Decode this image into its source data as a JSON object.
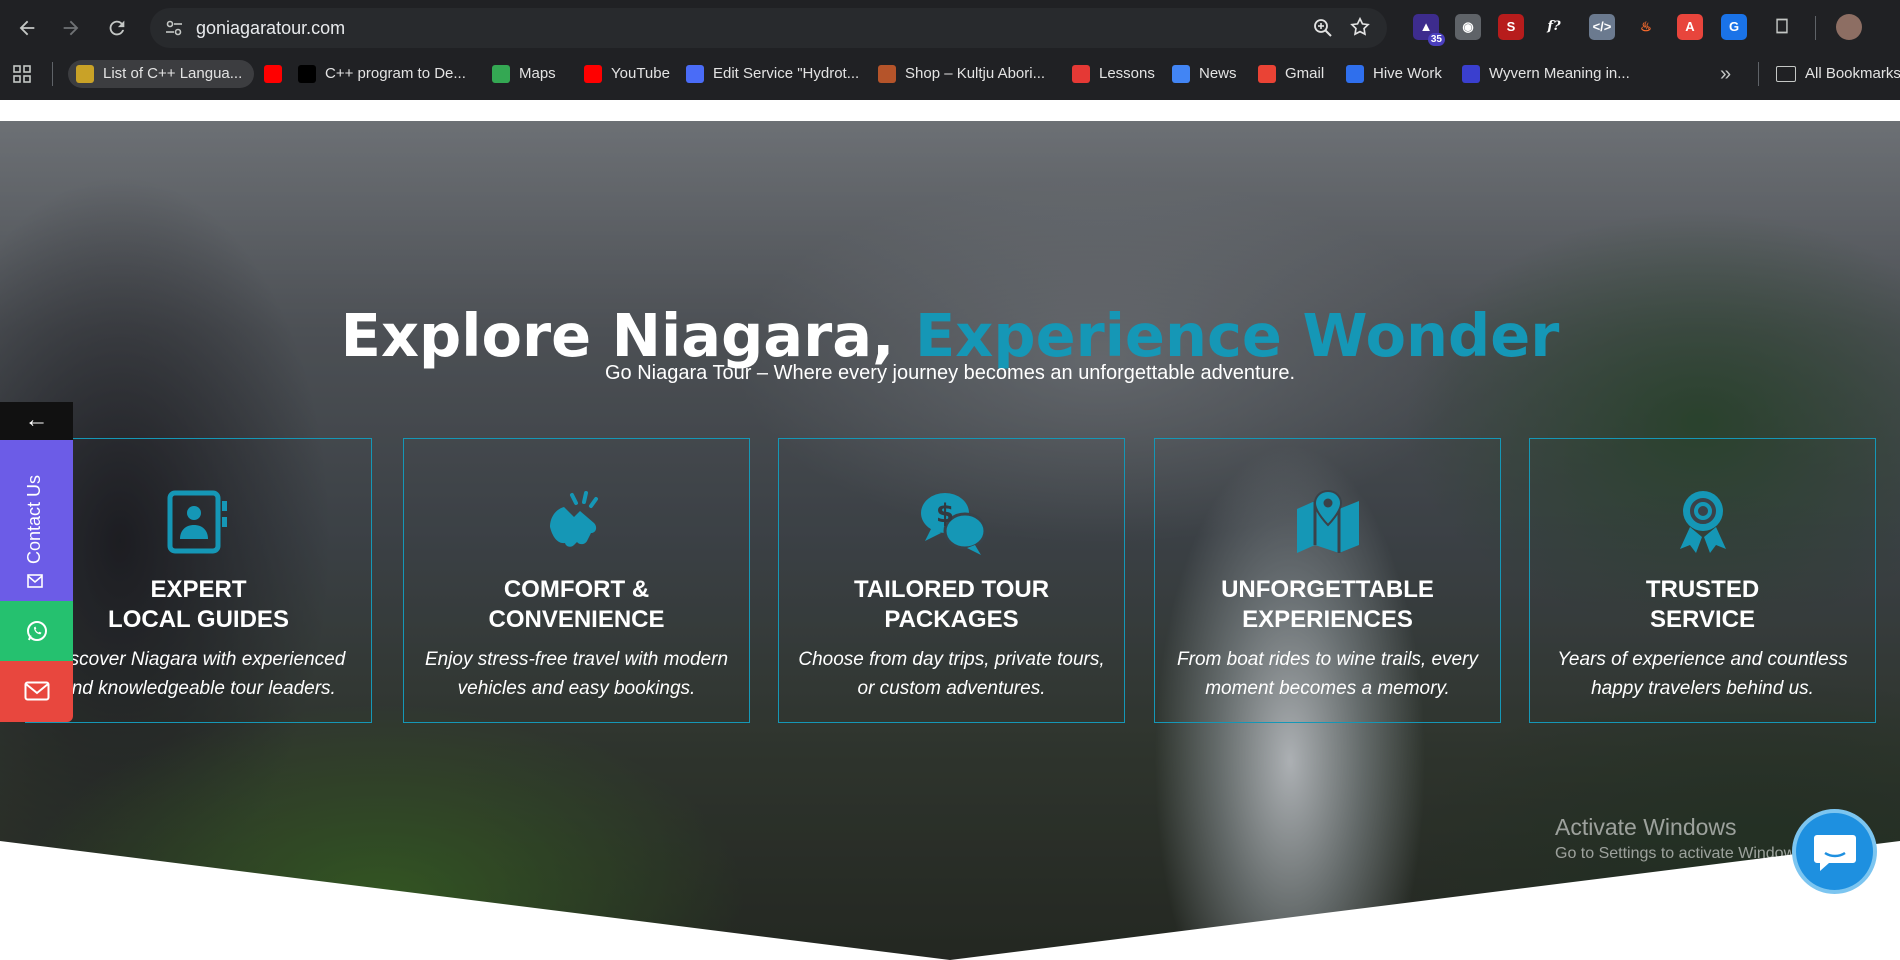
{
  "browser": {
    "url": "goniagaratour.com",
    "extension_badge": "35",
    "all_bookmarks_label": "All Bookmarks",
    "bookmarks": [
      {
        "label": "List of C++ Langua...",
        "icon": "pyramid-icon",
        "color": "#c9a227"
      },
      {
        "label": "",
        "icon": "youtube-icon",
        "color": "#ff0000"
      },
      {
        "label": "C++ program to De...",
        "icon": "s-logo-icon",
        "color": "#000000"
      },
      {
        "label": "Maps",
        "icon": "maps-pin-icon",
        "color": "#34a853"
      },
      {
        "label": "YouTube",
        "icon": "youtube-icon",
        "color": "#ff0000"
      },
      {
        "label": "Edit Service \"Hydrot...",
        "icon": "edit-service-icon",
        "color": "#4a6cf7"
      },
      {
        "label": "Shop – Kultju Abori...",
        "icon": "shop-icon",
        "color": "#b5542a"
      },
      {
        "label": "Lessons",
        "icon": "lessons-icon",
        "color": "#e53935"
      },
      {
        "label": "News",
        "icon": "news-icon",
        "color": "#4285f4"
      },
      {
        "label": "Gmail",
        "icon": "google-icon",
        "color": "#ea4335"
      },
      {
        "label": "Hive Work",
        "icon": "hive-icon",
        "color": "#2f6fed"
      },
      {
        "label": "Wyvern Meaning in...",
        "icon": "hw-icon",
        "color": "#3a3fcf"
      }
    ]
  },
  "hero": {
    "headline_main": "Explore Niagara,",
    "headline_accent": "Experience Wonder",
    "subline": "Go Niagara Tour – Where every journey becomes an unforgettable adventure.",
    "accent_color": "#1597b6"
  },
  "cards": [
    {
      "title": "EXPERT\nLOCAL GUIDES",
      "desc": "Discover Niagara with experienced\nand knowledgeable tour leaders.",
      "icon": "guide-id-card-icon"
    },
    {
      "title": "COMFORT &\nCONVENIENCE",
      "desc": "Enjoy stress-free travel with modern\nvehicles and easy bookings.",
      "icon": "handshake-icon"
    },
    {
      "title": "TAILORED TOUR\nPACKAGES",
      "desc": "Choose from day trips, private tours,\nor custom adventures.",
      "icon": "dollar-chat-icon"
    },
    {
      "title": "UNFORGETTABLE\nEXPERIENCES",
      "desc": "From boat rides to wine trails, every\nmoment becomes a memory.",
      "icon": "map-pin-icon"
    },
    {
      "title": "TRUSTED\nSERVICE",
      "desc": "Years of experience and countless\nhappy travelers behind us.",
      "icon": "award-ribbon-icon"
    }
  ],
  "side_widget": {
    "arrow": "←",
    "contact_label": "Contact Us",
    "contact_color": "#6c5ce7",
    "whatsapp_color": "#25c16f",
    "mail_color": "#e8473e"
  },
  "watermark": {
    "title": "Activate Windows",
    "subtitle": "Go to Settings to activate Windows."
  }
}
